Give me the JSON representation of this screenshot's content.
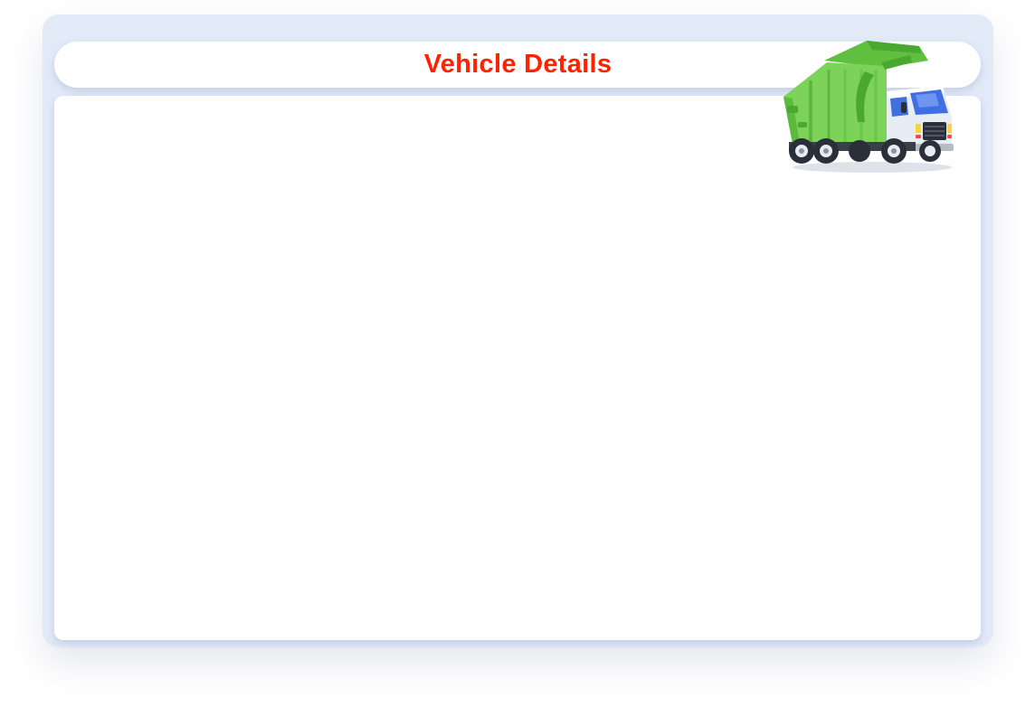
{
  "header": {
    "title": "Vehicle Details"
  },
  "icons": {
    "truck": "garbage-truck-icon"
  },
  "colors": {
    "title": "#ff2200",
    "outer_background": "#e2e9f7",
    "panel_background": "#ffffff",
    "truck_body": "#7dd35a",
    "truck_cab": "#e8ecf3",
    "truck_window": "#3f6fe0"
  }
}
